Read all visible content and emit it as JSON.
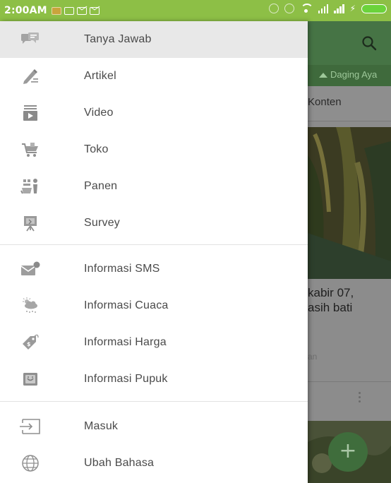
{
  "status_bar": {
    "time": "2:00AM"
  },
  "background": {
    "chip_label": "Daging Aya",
    "content_tab": "Konten",
    "caption_lines": [
      "kabir 07,",
      "asih bati"
    ],
    "sub": "an",
    "fab_symbol": "+"
  },
  "drawer": {
    "items": [
      {
        "label": "Tanya Jawab",
        "icon": "chat-bubbles-icon",
        "selected": true
      },
      {
        "label": "Artikel",
        "icon": "pencil-icon"
      },
      {
        "label": "Video",
        "icon": "video-player-icon"
      },
      {
        "label": "Toko",
        "icon": "shopping-cart-icon"
      },
      {
        "label": "Panen",
        "icon": "harvest-icon"
      },
      {
        "label": "Survey",
        "icon": "survey-board-icon"
      },
      {
        "label": "Informasi SMS",
        "icon": "sms-envelope-icon"
      },
      {
        "label": "Informasi Cuaca",
        "icon": "weather-cloud-icon"
      },
      {
        "label": "Informasi Harga",
        "icon": "price-tag-icon"
      },
      {
        "label": "Informasi Pupuk",
        "icon": "fertilizer-bag-icon"
      },
      {
        "label": "Masuk",
        "icon": "login-icon"
      },
      {
        "label": "Ubah Bahasa",
        "icon": "globe-icon"
      }
    ]
  },
  "colors": {
    "status_bar": "#8dbf46",
    "selected_row": "#e8e8e8",
    "icon_gray": "#9e9e9e",
    "app_header": "#467445"
  }
}
